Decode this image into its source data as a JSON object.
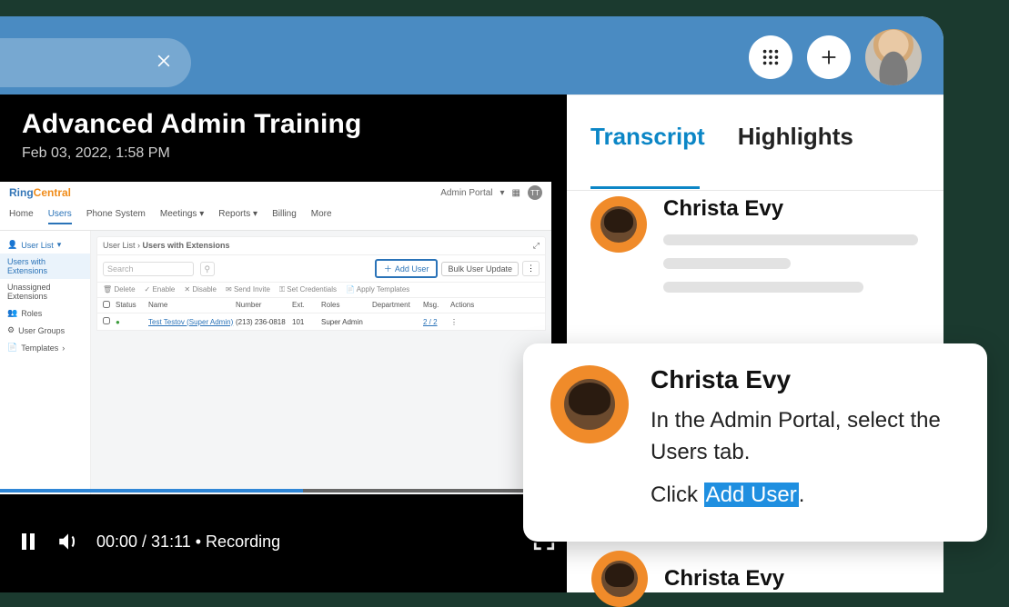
{
  "video": {
    "title": "Advanced Admin Training",
    "date": "Feb 03, 2022, 1:58 PM",
    "time_label": "00:00 / 31:11 • Recording"
  },
  "tabs": {
    "transcript": "Transcript",
    "highlights": "Highlights"
  },
  "transcript": {
    "speaker1": "Christa Evy",
    "popup_speaker": "Christa Evy",
    "popup_line1": "In the Admin Portal, select the Users tab.",
    "popup_line2a": "Click ",
    "popup_link": "Add User",
    "popup_line2b": ".",
    "speaker3": "Christa Evy"
  },
  "rc": {
    "portal_label": "Admin Portal",
    "avatar_initials": "TT",
    "tabs": {
      "home": "Home",
      "users": "Users",
      "phone": "Phone System",
      "meetings": "Meetings",
      "reports": "Reports",
      "billing": "Billing",
      "more": "More"
    },
    "side": {
      "user_list": "User List",
      "users_ext": "Users with Extensions",
      "unassigned": "Unassigned Extensions",
      "roles": "Roles",
      "user_groups": "User Groups",
      "templates": "Templates"
    },
    "bread1": "User List",
    "bread2": "Users with Extensions",
    "search_placeholder": "Search",
    "add_user": "Add User",
    "bulk": "Bulk User Update",
    "toolrow": {
      "delete": "Delete",
      "enable": "Enable",
      "disable": "Disable",
      "send_invite": "Send Invite",
      "set_cred": "Set Credentials",
      "apply_tpl": "Apply Templates"
    },
    "headers": {
      "status": "Status",
      "name": "Name",
      "number": "Number",
      "ext": "Ext.",
      "roles": "Roles",
      "dept": "Department",
      "msg": "Msg.",
      "actions": "Actions"
    },
    "row": {
      "name": "Test Testov (Super Admin)",
      "number": "(213) 236-0818",
      "ext": "101",
      "role": "Super Admin",
      "msg": "2 / 2"
    }
  }
}
